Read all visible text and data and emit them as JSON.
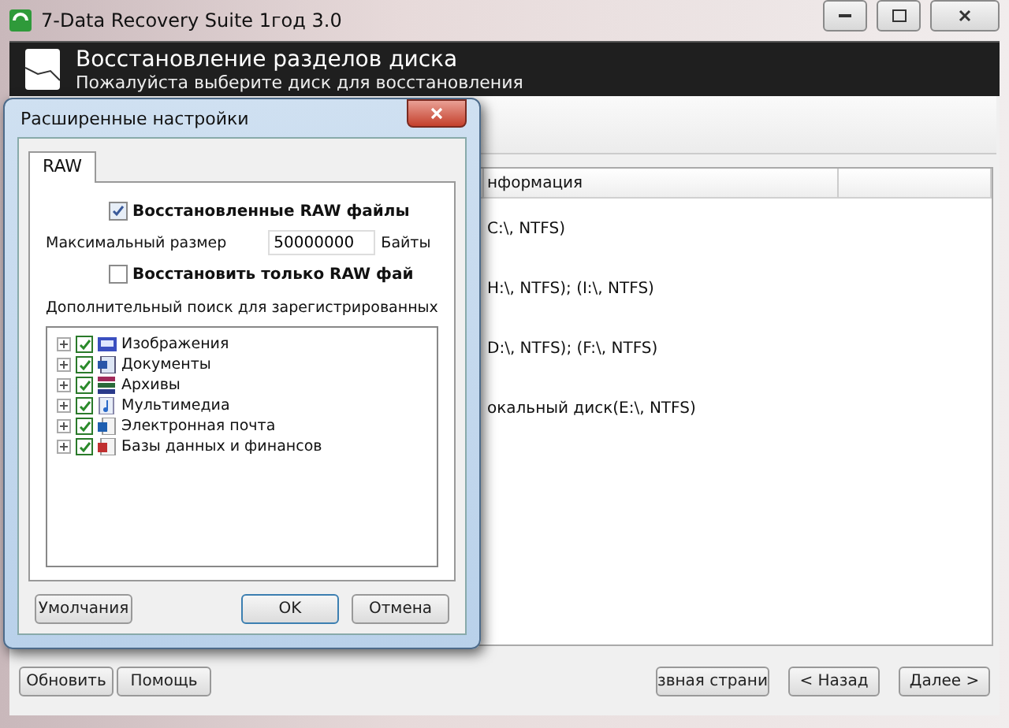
{
  "window": {
    "title": "7-Data Recovery Suite 1год 3.0"
  },
  "header": {
    "title": "Восстановление разделов диска",
    "subtitle": "Пожалуйста выберите диск для восстановления"
  },
  "table": {
    "columns": [
      "нформация"
    ],
    "rows": [
      {
        "info": "C:\\, NTFS)"
      },
      {
        "info": "H:\\, NTFS); (I:\\, NTFS)"
      },
      {
        "info": "D:\\, NTFS); (F:\\, NTFS)"
      },
      {
        "info": "окальный диск(E:\\, NTFS)"
      }
    ]
  },
  "buttons_left": [
    "Обновить",
    "Помощь"
  ],
  "buttons_right": [
    "звная страни",
    "< Назад",
    "Далее >"
  ],
  "dialog": {
    "title": "Расширенные настройки",
    "tabs": [
      {
        "label": "RAW",
        "selected": true
      }
    ],
    "recover_raw": {
      "label": "Восстановленные RAW файлы",
      "checked": true
    },
    "max_size": {
      "label": "Максимальный размер",
      "value": "50000000",
      "unit": "Байты"
    },
    "raw_only": {
      "label": "Восстановить только RAW фай",
      "checked": false
    },
    "extra_label": "Дополнительный поиск для зарегистрированных",
    "file_types": [
      {
        "kind": "image",
        "label": "Изображения",
        "checked": true
      },
      {
        "kind": "document",
        "label": "Документы",
        "checked": true
      },
      {
        "kind": "archive",
        "label": "Архивы",
        "checked": true
      },
      {
        "kind": "media",
        "label": "Мультимедиа",
        "checked": true
      },
      {
        "kind": "email",
        "label": "Электронная почта",
        "checked": true
      },
      {
        "kind": "database",
        "label": "Базы данных и финансов",
        "checked": true
      }
    ],
    "buttons": [
      {
        "label": "Умолчания",
        "default": false
      },
      {
        "label": "OK",
        "default": true
      },
      {
        "label": "Отмена",
        "default": false
      }
    ]
  }
}
